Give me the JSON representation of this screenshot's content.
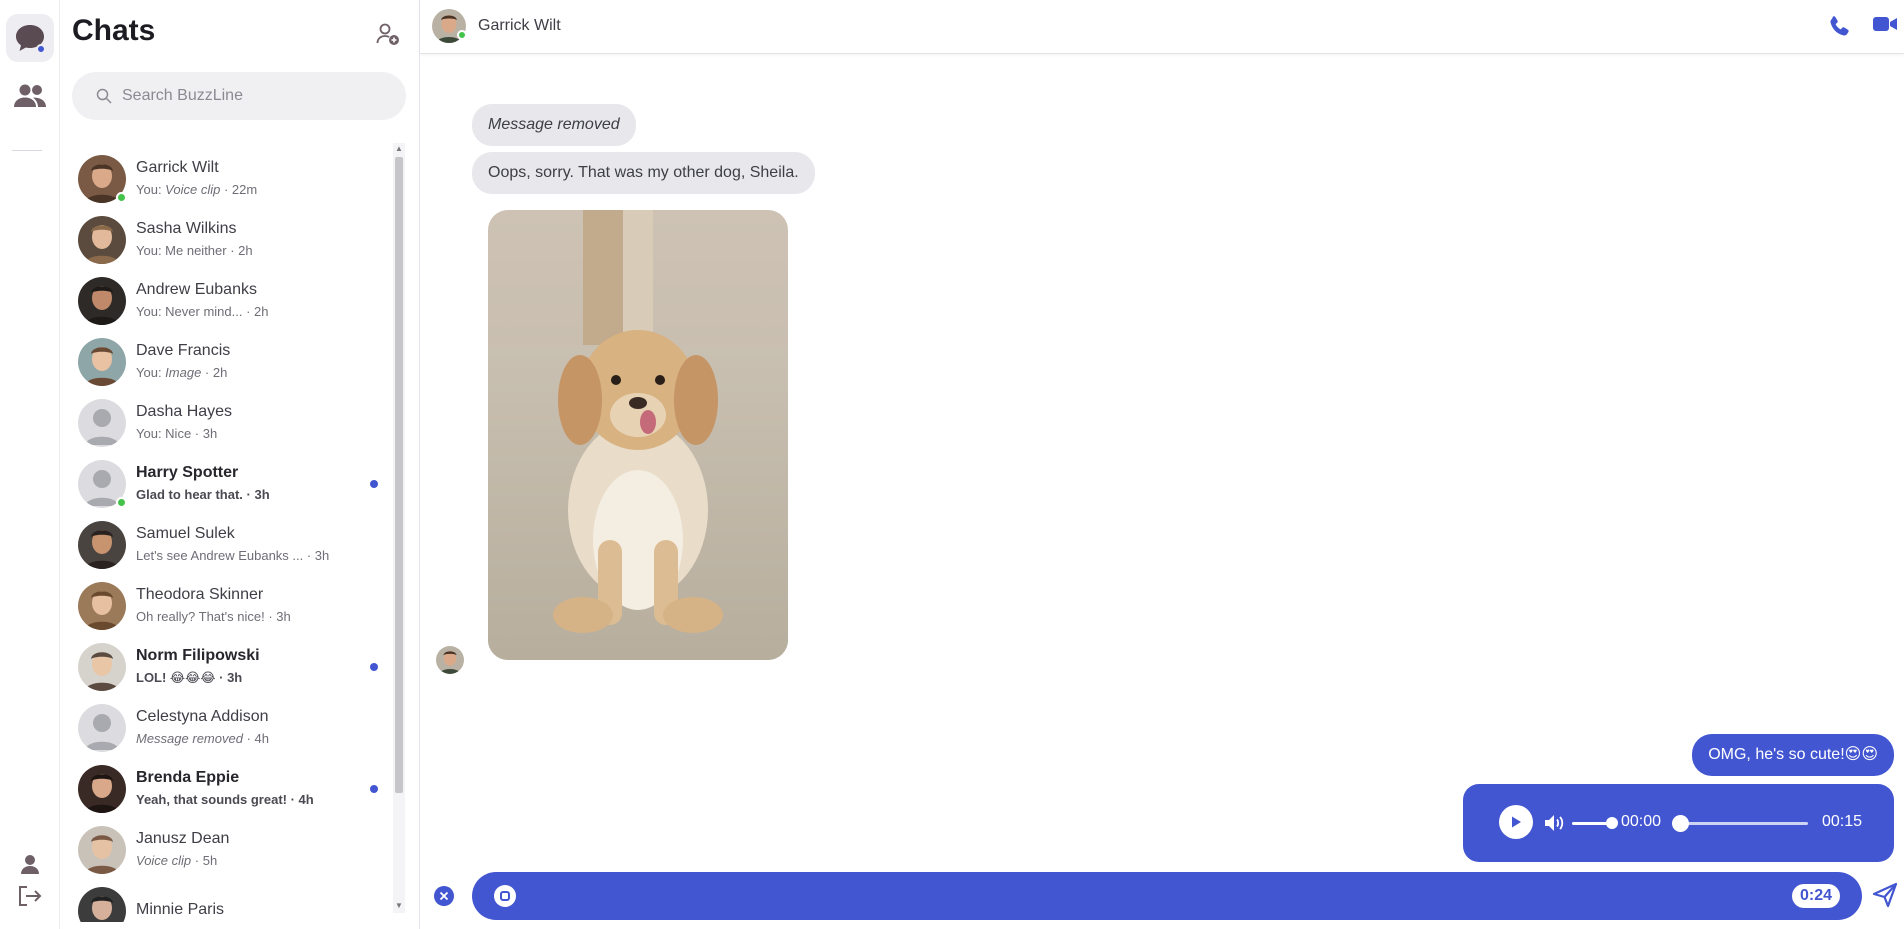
{
  "app": {
    "name": "BuzzLine"
  },
  "colors": {
    "accent": "#4356d1",
    "online": "#44c24a",
    "incoming_bubble": "#e7e7ec"
  },
  "rail": {
    "items": [
      {
        "icon": "chat-bubble-icon",
        "active": true
      },
      {
        "icon": "people-icon",
        "active": false
      }
    ],
    "bottom": [
      {
        "icon": "profile-icon"
      },
      {
        "icon": "logout-icon"
      }
    ]
  },
  "chats": {
    "title": "Chats",
    "new_chat_icon": "add-person-icon",
    "search_placeholder": "Search BuzzLine",
    "items": [
      {
        "name": "Garrick Wilt",
        "prefix": "You: ",
        "preview": "Voice clip",
        "preview_italic": true,
        "time": " · 22m",
        "online": true,
        "unread": false,
        "avatar": "photo"
      },
      {
        "name": "Sasha Wilkins",
        "prefix": "You: ",
        "preview": "Me neither",
        "preview_italic": false,
        "time": " · 2h",
        "online": false,
        "unread": false,
        "avatar": "photo"
      },
      {
        "name": "Andrew Eubanks",
        "prefix": "You: ",
        "preview": "Never mind...",
        "preview_italic": false,
        "time": " · 2h",
        "online": false,
        "unread": false,
        "avatar": "photo"
      },
      {
        "name": "Dave Francis",
        "prefix": "You: ",
        "preview": "Image",
        "preview_italic": true,
        "time": " · 2h",
        "online": false,
        "unread": false,
        "avatar": "photo"
      },
      {
        "name": "Dasha Hayes",
        "prefix": "You: ",
        "preview": "Nice",
        "preview_italic": false,
        "time": " · 3h",
        "online": false,
        "unread": false,
        "avatar": "placeholder"
      },
      {
        "name": "Harry Spotter",
        "prefix": "",
        "preview": "Glad to hear that.",
        "preview_italic": false,
        "time": " · 3h",
        "online": true,
        "unread": true,
        "avatar": "placeholder"
      },
      {
        "name": "Samuel Sulek",
        "prefix": "",
        "preview": "Let's see Andrew Eubanks ...",
        "preview_italic": false,
        "time": " · 3h",
        "online": false,
        "unread": false,
        "avatar": "photo"
      },
      {
        "name": "Theodora Skinner",
        "prefix": "",
        "preview": "Oh really? That's nice!",
        "preview_italic": false,
        "time": " · 3h",
        "online": false,
        "unread": false,
        "avatar": "photo"
      },
      {
        "name": "Norm Filipowski",
        "prefix": "",
        "preview": "LOL! 😂😂😂",
        "preview_italic": false,
        "time": " · 3h",
        "online": false,
        "unread": true,
        "avatar": "photo"
      },
      {
        "name": "Celestyna Addison",
        "prefix": "",
        "preview": "Message removed",
        "preview_italic": true,
        "time": " · 4h",
        "online": false,
        "unread": false,
        "avatar": "placeholder"
      },
      {
        "name": "Brenda Eppie",
        "prefix": "",
        "preview": "Yeah, that sounds great!",
        "preview_italic": false,
        "time": " · 4h",
        "online": false,
        "unread": true,
        "avatar": "photo"
      },
      {
        "name": "Janusz Dean",
        "prefix": "",
        "preview": "Voice clip",
        "preview_italic": true,
        "time": " · 5h",
        "online": false,
        "unread": false,
        "avatar": "photo"
      },
      {
        "name": "Minnie Paris",
        "prefix": "",
        "preview": "",
        "preview_italic": false,
        "time": "",
        "online": false,
        "unread": false,
        "avatar": "photo"
      }
    ]
  },
  "conversation": {
    "contact": "Garrick Wilt",
    "online": true,
    "actions": [
      "phone-icon",
      "video-icon"
    ],
    "messages": {
      "removed": "Message removed",
      "sorry": "Oops, sorry. That was my other dog, Sheila.",
      "image": "puppy-photo",
      "outgoing": "OMG, he's so cute!😍😍"
    },
    "voice_clip": {
      "current": "00:00",
      "total": "00:15",
      "progress": 0,
      "volume": 0.9
    },
    "recording": {
      "elapsed": "0:24"
    }
  }
}
